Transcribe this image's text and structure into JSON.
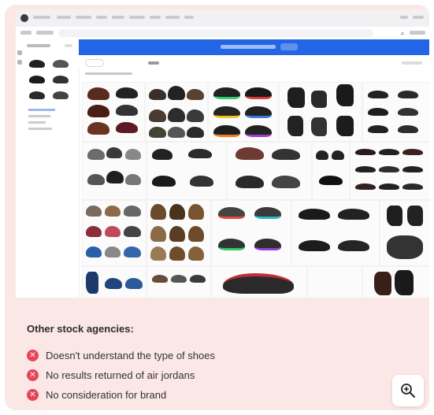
{
  "section": {
    "heading": "Other stock agencies:",
    "issues": [
      "Doesn't understand the type of shoes",
      "No results returned of air jordans",
      "No consideration for brand"
    ]
  },
  "icons": {
    "issue_icon": "x-circle-icon",
    "zoom_icon": "zoom-in-icon"
  },
  "colors": {
    "card_background": "#fbe8e6",
    "issue_icon": "#e8455a",
    "banner": "#2266e6"
  }
}
